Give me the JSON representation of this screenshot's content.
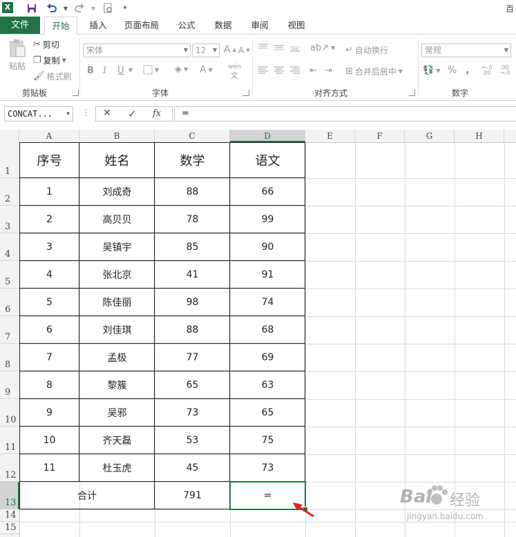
{
  "titlebar": {
    "icons": [
      "excel-logo",
      "save-icon",
      "undo-icon",
      "redo-icon",
      "print-preview-icon",
      "customize-icon"
    ],
    "partial_title": "百"
  },
  "tabs": {
    "file": "文件",
    "items": [
      "开始",
      "插入",
      "页面布局",
      "公式",
      "数据",
      "审阅",
      "视图"
    ],
    "active": "开始"
  },
  "ribbon": {
    "clipboard": {
      "paste": "粘贴",
      "cut": "剪切",
      "copy": "复制",
      "format_painter": "格式刷",
      "label": "剪贴板"
    },
    "font": {
      "font_name": "宋体",
      "font_size": "12",
      "bold": "B",
      "italic": "I",
      "underline": "U",
      "phonetic": "wén",
      "label": "字体"
    },
    "alignment": {
      "wrap_text": "自动换行",
      "merge_center": "合并后居中",
      "label": "对齐方式"
    },
    "number": {
      "format": "常规",
      "percent": "%",
      "comma": ",",
      "label": "数字"
    }
  },
  "formula_bar": {
    "name_box": "CONCAT...",
    "cancel": "✕",
    "enter": "✓",
    "fx": "fx",
    "formula": "="
  },
  "columns": [
    "A",
    "B",
    "C",
    "D",
    "E",
    "F",
    "G",
    "H"
  ],
  "selected_column": "D",
  "rows": [
    "1",
    "2",
    "3",
    "4",
    "5",
    "6",
    "7",
    "8",
    "9",
    "10",
    "11",
    "12",
    "13",
    "14",
    "15"
  ],
  "selected_row": "13",
  "table": {
    "headers": [
      "序号",
      "姓名",
      "数学",
      "语文"
    ],
    "rows": [
      [
        "1",
        "刘成奇",
        "88",
        "66"
      ],
      [
        "2",
        "高贝贝",
        "78",
        "99"
      ],
      [
        "3",
        "吴镇宇",
        "85",
        "90"
      ],
      [
        "4",
        "张北京",
        "41",
        "91"
      ],
      [
        "5",
        "陈佳丽",
        "98",
        "74"
      ],
      [
        "6",
        "刘佳琪",
        "88",
        "68"
      ],
      [
        "7",
        "孟极",
        "77",
        "69"
      ],
      [
        "8",
        "黎簇",
        "65",
        "63"
      ],
      [
        "9",
        "吴邪",
        "73",
        "65"
      ],
      [
        "10",
        "齐天磊",
        "53",
        "75"
      ],
      [
        "11",
        "杜玉虎",
        "45",
        "73"
      ]
    ],
    "total_label": "合计",
    "total_math": "791",
    "total_chinese_editing": "="
  },
  "watermark": {
    "brand": "Bai",
    "brand2": "经验",
    "url": "jingyan.baidu.com"
  },
  "colors": {
    "excel_green": "#217346",
    "arrow_red": "#e02020"
  }
}
